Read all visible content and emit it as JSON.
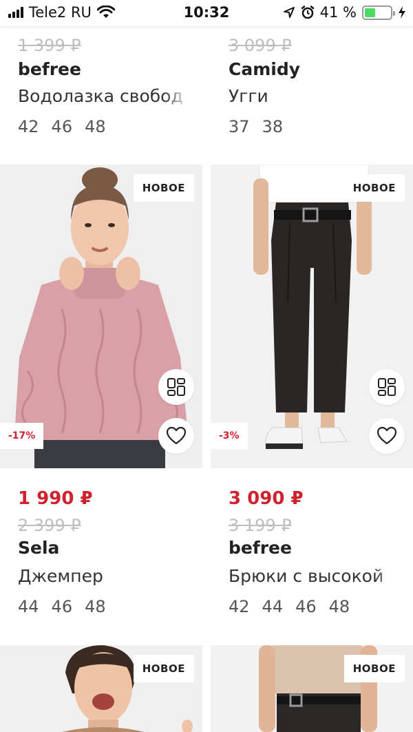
{
  "status_bar": {
    "carrier": "Tele2 RU",
    "time": "10:32",
    "battery_percent": "41 %",
    "battery_level": 0.41,
    "icons": [
      "signal-icon",
      "wifi-icon",
      "location-icon",
      "alarm-icon",
      "battery-icon",
      "charging-icon"
    ]
  },
  "products": [
    {
      "old_price": "1 399 ₽",
      "brand": "befree",
      "name": "Водолазка свобод",
      "sizes": [
        "42",
        "46",
        "48"
      ]
    },
    {
      "old_price": "3 099 ₽",
      "brand": "Camidy",
      "name": "Угги",
      "sizes": [
        "37",
        "38"
      ]
    },
    {
      "badge": "НОВОЕ",
      "discount": "-17%",
      "price": "1 990 ₽",
      "old_price": "2 399 ₽",
      "brand": "Sela",
      "name": "Джемпер",
      "sizes": [
        "44",
        "46",
        "48"
      ]
    },
    {
      "badge": "НОВОЕ",
      "discount": "-3%",
      "price": "3 090 ₽",
      "old_price": "3 199 ₽",
      "brand": "befree",
      "name": "Брюки с высокой",
      "sizes": [
        "42",
        "44",
        "46",
        "48"
      ]
    },
    {
      "badge": "НОВОЕ"
    },
    {
      "badge": "НОВОЕ"
    }
  ],
  "colors": {
    "price_red": "#d0222e",
    "old_price_gray": "#bdbdbd",
    "photo_bg": "#efefef",
    "battery_green": "#4cd964"
  }
}
